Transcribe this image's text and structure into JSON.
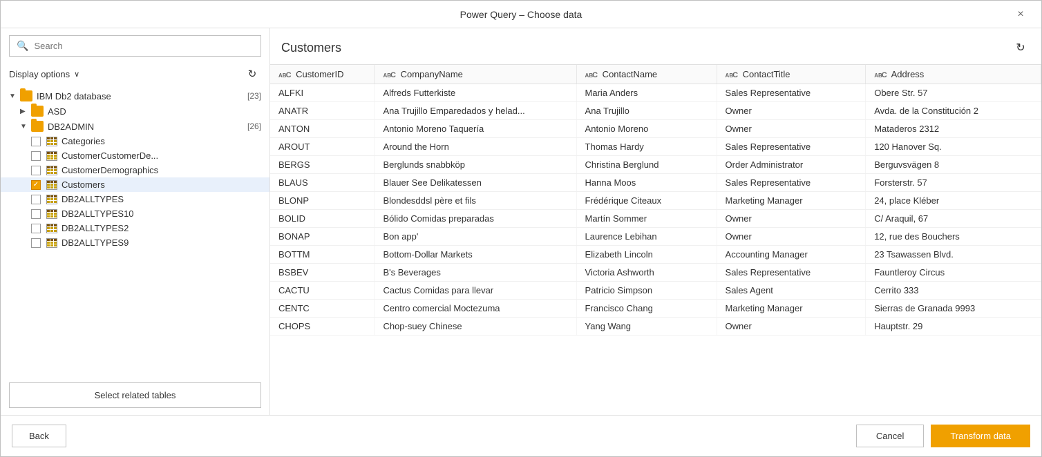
{
  "dialog": {
    "title": "Power Query – Choose data",
    "close_label": "×"
  },
  "left_panel": {
    "search": {
      "placeholder": "Search",
      "value": ""
    },
    "display_options": {
      "label": "Display options",
      "chevron": "∨"
    },
    "refresh_tooltip": "Refresh",
    "tree": {
      "root": {
        "label": "IBM Db2 database",
        "count": "[23]",
        "expanded": true,
        "children": [
          {
            "type": "folder",
            "label": "ASD",
            "expanded": false,
            "children": []
          },
          {
            "type": "folder",
            "label": "DB2ADMIN",
            "count": "[26]",
            "expanded": true,
            "children": [
              {
                "type": "table",
                "label": "Categories",
                "checked": false
              },
              {
                "type": "table",
                "label": "CustomerCustomerDe...",
                "checked": false
              },
              {
                "type": "table",
                "label": "CustomerDemographics",
                "checked": false
              },
              {
                "type": "table",
                "label": "Customers",
                "checked": true,
                "selected": true
              },
              {
                "type": "table",
                "label": "DB2ALLTYPES",
                "checked": false
              },
              {
                "type": "table",
                "label": "DB2ALLTYPES10",
                "checked": false
              },
              {
                "type": "table",
                "label": "DB2ALLTYPES2",
                "checked": false
              },
              {
                "type": "table",
                "label": "DB2ALLTYPES9",
                "checked": false
              }
            ]
          }
        ]
      }
    },
    "select_related_tables": "Select related tables",
    "back": "Back"
  },
  "right_panel": {
    "title": "Customers",
    "columns": [
      {
        "name": "CustomerID",
        "type": "ABC"
      },
      {
        "name": "CompanyName",
        "type": "ABC"
      },
      {
        "name": "ContactName",
        "type": "ABC"
      },
      {
        "name": "ContactTitle",
        "type": "ABC"
      },
      {
        "name": "Address",
        "type": "ABC"
      }
    ],
    "rows": [
      [
        "ALFKI",
        "Alfreds Futterkiste",
        "Maria Anders",
        "Sales Representative",
        "Obere Str. 57"
      ],
      [
        "ANATR",
        "Ana Trujillo Emparedados y helad...",
        "Ana Trujillo",
        "Owner",
        "Avda. de la Constitución 2"
      ],
      [
        "ANTON",
        "Antonio Moreno Taquería",
        "Antonio Moreno",
        "Owner",
        "Mataderos 2312"
      ],
      [
        "AROUT",
        "Around the Horn",
        "Thomas Hardy",
        "Sales Representative",
        "120 Hanover Sq."
      ],
      [
        "BERGS",
        "Berglunds snabbköp",
        "Christina Berglund",
        "Order Administrator",
        "Berguvsvägen 8"
      ],
      [
        "BLAUS",
        "Blauer See Delikatessen",
        "Hanna Moos",
        "Sales Representative",
        "Forsterstr. 57"
      ],
      [
        "BLONP",
        "Blondesddsl père et fils",
        "Frédérique Citeaux",
        "Marketing Manager",
        "24, place Kléber"
      ],
      [
        "BOLID",
        "Bólido Comidas preparadas",
        "Martín Sommer",
        "Owner",
        "C/ Araquil, 67"
      ],
      [
        "BONAP",
        "Bon app'",
        "Laurence Lebihan",
        "Owner",
        "12, rue des Bouchers"
      ],
      [
        "BOTTM",
        "Bottom-Dollar Markets",
        "Elizabeth Lincoln",
        "Accounting Manager",
        "23 Tsawassen Blvd."
      ],
      [
        "BSBEV",
        "B's Beverages",
        "Victoria Ashworth",
        "Sales Representative",
        "Fauntleroy Circus"
      ],
      [
        "CACTU",
        "Cactus Comidas para llevar",
        "Patricio Simpson",
        "Sales Agent",
        "Cerrito 333"
      ],
      [
        "CENTC",
        "Centro comercial Moctezuma",
        "Francisco Chang",
        "Marketing Manager",
        "Sierras de Granada 9993"
      ],
      [
        "CHOPS",
        "Chop-suey Chinese",
        "Yang Wang",
        "Owner",
        "Hauptstr. 29"
      ]
    ]
  },
  "footer": {
    "back_label": "Back",
    "cancel_label": "Cancel",
    "transform_label": "Transform data"
  }
}
